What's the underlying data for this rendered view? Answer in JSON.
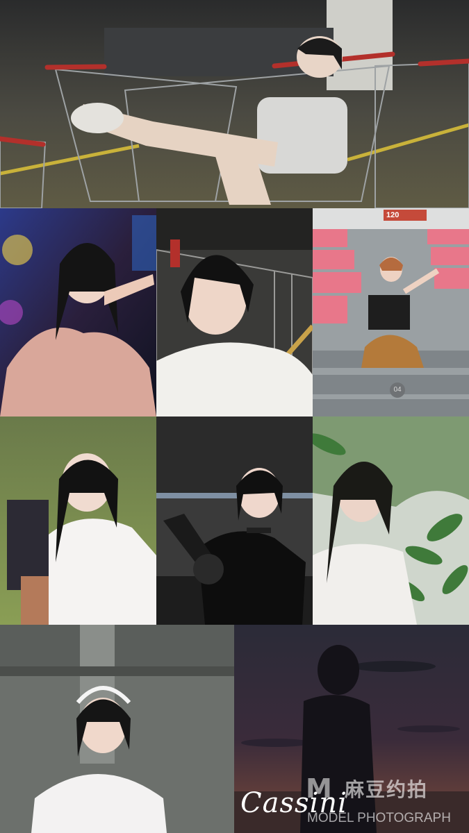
{
  "collage": {
    "photos": [
      {
        "subject": "model reclining in shopping cart in parking garage"
      },
      {
        "subject": "model in pink top at arcade"
      },
      {
        "subject": "model in white tee by shopping cart"
      },
      {
        "subject": "model sitting on stadium steps"
      },
      {
        "subject": "model in white blouse outdoors"
      },
      {
        "subject": "model in black top holding prop gun"
      },
      {
        "subject": "model among green leaves"
      },
      {
        "subject": "model in white tee with headband"
      },
      {
        "subject": "silhouette at dusk"
      }
    ],
    "stand_sign": "120",
    "step_number": "04"
  },
  "watermark": {
    "signature": "Cassini",
    "brand_mark": "M",
    "brand_cn": "麻豆约拍",
    "brand_en": "MODEL PHOTOGRAPH"
  },
  "colors": {
    "stadium_seat": "#e8778a",
    "dusk_sky": "#3a2b3a",
    "cart_red": "#b3302b"
  }
}
